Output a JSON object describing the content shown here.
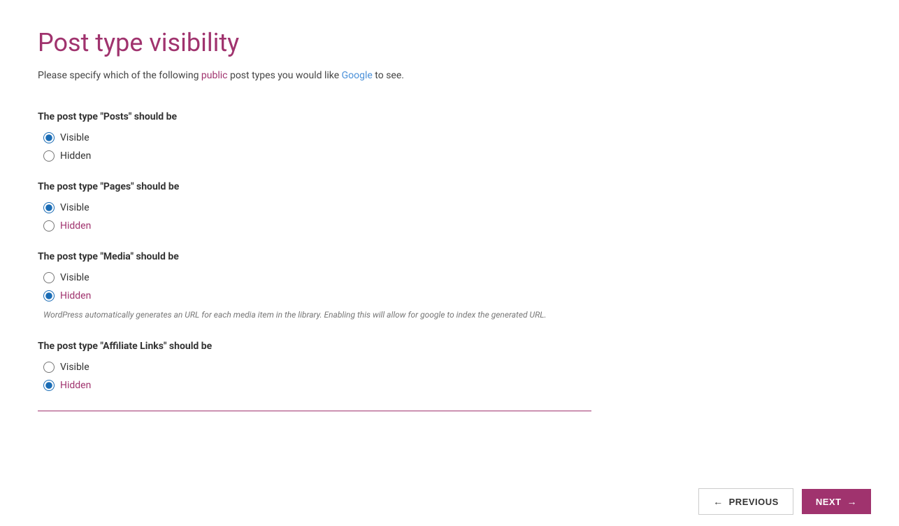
{
  "page": {
    "title": "Post type visibility",
    "description_parts": [
      "Please specify which of the following ",
      "public",
      " post types you would like ",
      "Google",
      " to see."
    ]
  },
  "sections": [
    {
      "id": "posts",
      "label": "The post type \"Posts\" should be",
      "options": [
        {
          "value": "visible",
          "label": "Visible",
          "checked": true,
          "hidden_style": false
        },
        {
          "value": "hidden",
          "label": "Hidden",
          "checked": false,
          "hidden_style": false
        }
      ],
      "note": null
    },
    {
      "id": "pages",
      "label": "The post type \"Pages\" should be",
      "options": [
        {
          "value": "visible",
          "label": "Visible",
          "checked": true,
          "hidden_style": false
        },
        {
          "value": "hidden",
          "label": "Hidden",
          "checked": false,
          "hidden_style": true
        }
      ],
      "note": null
    },
    {
      "id": "media",
      "label": "The post type \"Media\" should be",
      "options": [
        {
          "value": "visible",
          "label": "Visible",
          "checked": false,
          "hidden_style": false
        },
        {
          "value": "hidden",
          "label": "Hidden",
          "checked": true,
          "hidden_style": true
        }
      ],
      "note": "WordPress automatically generates an URL for each media item in the library. Enabling this will allow for google to index the generated URL."
    },
    {
      "id": "affiliate-links",
      "label": "The post type \"Affiliate Links\" should be",
      "options": [
        {
          "value": "visible",
          "label": "Visible",
          "checked": false,
          "hidden_style": false
        },
        {
          "value": "hidden",
          "label": "Hidden",
          "checked": true,
          "hidden_style": true
        }
      ],
      "note": null
    }
  ],
  "footer": {
    "previous_label": "PREVIOUS",
    "next_label": "NEXT"
  }
}
